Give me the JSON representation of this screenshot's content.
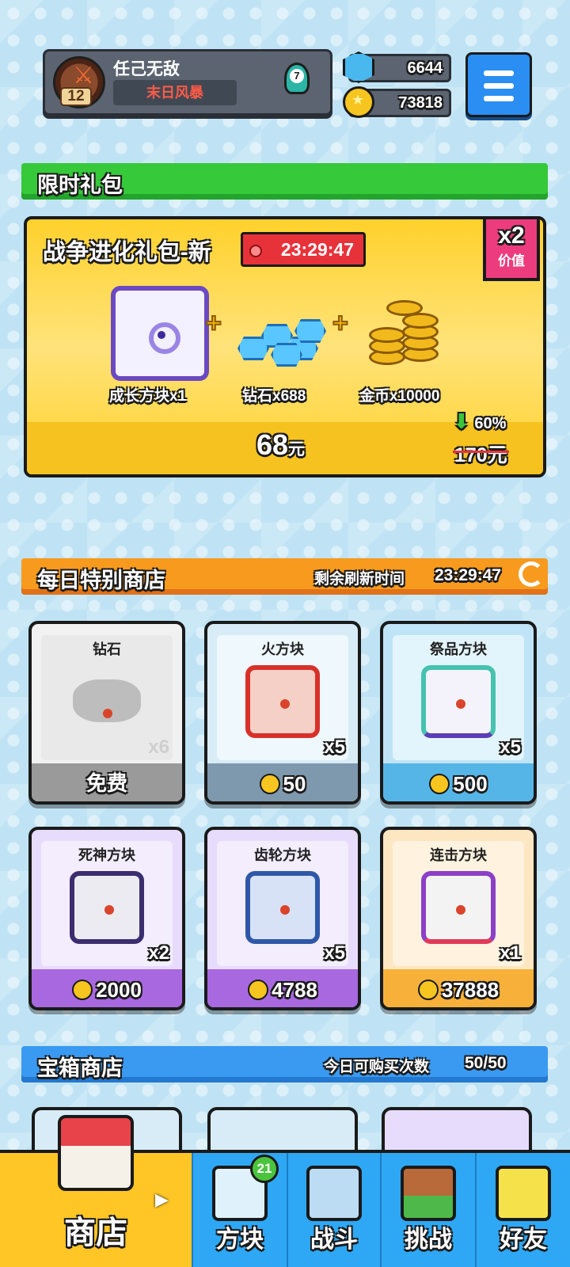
{
  "profile": {
    "name": "任己无敌",
    "title": "末日风暴",
    "level": "12",
    "rank": "7"
  },
  "currency": {
    "gems": "6644",
    "gold": "73818"
  },
  "limited": {
    "header": "限时礼包",
    "pack_title": "战争进化礼包-新",
    "timer": "23:29:47",
    "multiplier": "x2",
    "multiplier_label": "价值",
    "items": [
      {
        "label": "成长方块x1",
        "icon": "growth-block"
      },
      {
        "label": "钻石x688",
        "icon": "gems"
      },
      {
        "label": "金币x10000",
        "icon": "gold-coins"
      }
    ],
    "price": "68",
    "price_unit": "元",
    "old_price": "170元",
    "discount": "60%"
  },
  "daily": {
    "header": "每日特别商店",
    "refresh_label": "剩余刷新时间",
    "refresh_time": "23:29:47",
    "cards": [
      {
        "name": "钻石",
        "qty": "x6",
        "price": "免费",
        "currency": "none"
      },
      {
        "name": "火方块",
        "qty": "x5",
        "price": "50",
        "currency": "gold"
      },
      {
        "name": "祭品方块",
        "qty": "x5",
        "price": "500",
        "currency": "gold"
      },
      {
        "name": "死神方块",
        "qty": "x2",
        "price": "2000",
        "currency": "gold"
      },
      {
        "name": "齿轮方块",
        "qty": "x5",
        "price": "4788",
        "currency": "gold"
      },
      {
        "name": "连击方块",
        "qty": "x1",
        "price": "37888",
        "currency": "gold"
      }
    ]
  },
  "chest": {
    "header": "宝箱商店",
    "limit_label": "今日可购买次数",
    "limit_value": "50/50"
  },
  "nav": {
    "shop": "商店",
    "blocks": "方块",
    "battle": "战斗",
    "challenge": "挑战",
    "friends": "好友",
    "blocks_badge": "21"
  },
  "colors": {
    "accent_green": "#36c93a",
    "accent_orange": "#f79a1e",
    "accent_blue": "#3a9af1",
    "pack_yellow": "#ffd12c",
    "timer_red": "#e8323a"
  }
}
